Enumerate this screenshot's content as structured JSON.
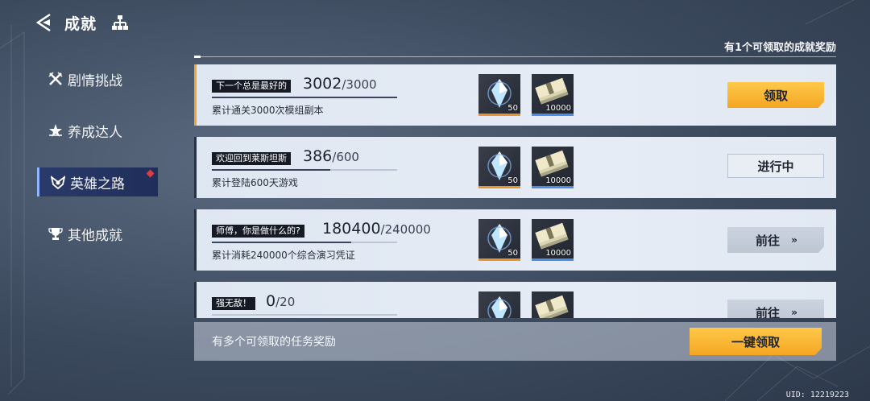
{
  "header": {
    "title": "成就"
  },
  "sidebar": {
    "items": [
      {
        "label": "剧情挑战",
        "icon": "crossed-swords-icon"
      },
      {
        "label": "养成达人",
        "icon": "star-rank-icon"
      },
      {
        "label": "英雄之路",
        "icon": "hero-emblem-icon",
        "active": true,
        "badge": true
      },
      {
        "label": "其他成就",
        "icon": "trophy-icon"
      }
    ]
  },
  "notice": "有1个可领取的成就奖励",
  "achievements": [
    {
      "tag": "下一个总是最好的",
      "current": "3002",
      "total": "/3000",
      "progress": 1.0,
      "desc": "累计通关3000次模组副本",
      "reward1": "50",
      "reward2": "10000",
      "button": "领取",
      "state": "claim"
    },
    {
      "tag": "欢迎回到莱斯坦斯",
      "current": "386",
      "total": "/600",
      "progress": 0.64,
      "desc": "累计登陆600天游戏",
      "reward1": "50",
      "reward2": "10000",
      "button": "进行中",
      "state": "progress"
    },
    {
      "tag": "师傅，你是做什么的?",
      "current": "180400",
      "total": "/240000",
      "progress": 0.75,
      "desc": "累计消耗240000个综合演习凭证",
      "reward1": "50",
      "reward2": "10000",
      "button": "前往",
      "chevron": "››",
      "state": "goto"
    },
    {
      "tag": "强无敌！",
      "current": "0",
      "total": "/20",
      "progress": 0.0,
      "desc": "",
      "reward1": "",
      "reward2": "",
      "button": "前往",
      "chevron": "››",
      "state": "goto"
    }
  ],
  "footer": {
    "text": "有多个可领取的任务奖励",
    "button": "一键领取"
  },
  "uid": "UID: 12219223",
  "colors": {
    "accent": "#f5a623",
    "active_nav": "#2a3a6a",
    "badge": "#e23b3b"
  }
}
